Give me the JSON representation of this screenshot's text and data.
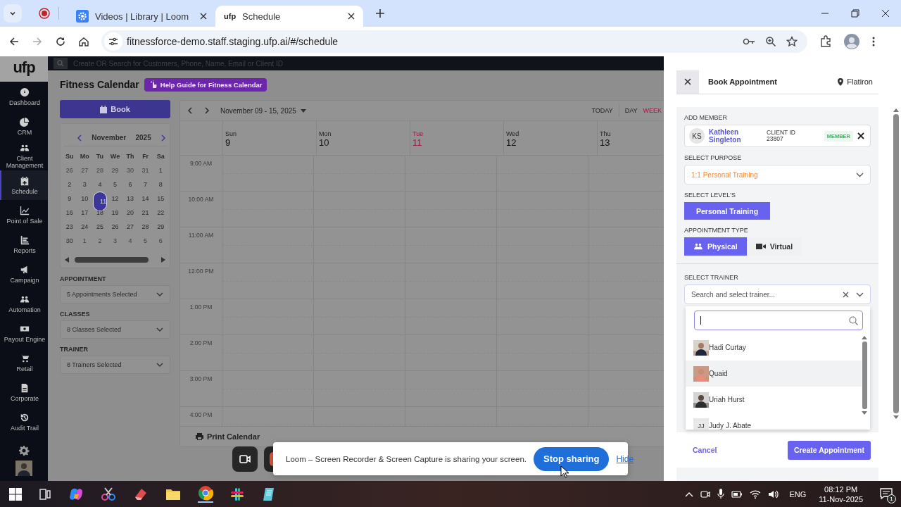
{
  "browser": {
    "tabs": [
      {
        "title": "Videos | Library | Loom",
        "selected": false
      },
      {
        "title": "Schedule",
        "logo": "ufp",
        "selected": true
      }
    ],
    "url": "fitnessforce-demo.staff.staging.ufp.ai/#/schedule"
  },
  "app": {
    "logo": "ufp",
    "search_placeholder": "Create OR Search for Customers, Phone, Name, Email or Client ID",
    "nav": [
      {
        "label": "Dashboard",
        "selected": false
      },
      {
        "label": "CRM",
        "selected": false
      },
      {
        "label": "Client Management",
        "selected": false
      },
      {
        "label": "Schedule",
        "selected": true
      },
      {
        "label": "Point of Sale",
        "selected": false
      },
      {
        "label": "Reports",
        "selected": false
      },
      {
        "label": "Campaign",
        "selected": false
      },
      {
        "label": "Automation",
        "selected": false
      },
      {
        "label": "Payout Engine",
        "selected": false
      },
      {
        "label": "Retail",
        "selected": false
      },
      {
        "label": "Corporate",
        "selected": false
      },
      {
        "label": "Audit Trail",
        "selected": false
      }
    ]
  },
  "calendar": {
    "title": "Fitness Calendar",
    "help": "Help Guide for Fitness Calendar",
    "book": "Book",
    "mini": {
      "month": "November",
      "year": "2025",
      "weekdays": [
        "Su",
        "Mo",
        "Tu",
        "We",
        "Th",
        "Fr",
        "Sa"
      ],
      "weeks": [
        [
          {
            "d": "26",
            "outside": true,
            "selected": false
          },
          {
            "d": "27",
            "outside": true,
            "selected": false
          },
          {
            "d": "28",
            "outside": true,
            "selected": false
          },
          {
            "d": "29",
            "outside": true,
            "selected": false
          },
          {
            "d": "30",
            "outside": true,
            "selected": false
          },
          {
            "d": "31",
            "outside": true,
            "selected": false
          },
          {
            "d": "1",
            "outside": false,
            "selected": false
          }
        ],
        [
          {
            "d": "2",
            "outside": false,
            "selected": false
          },
          {
            "d": "3",
            "outside": false,
            "selected": false
          },
          {
            "d": "4",
            "outside": false,
            "selected": false
          },
          {
            "d": "5",
            "outside": false,
            "selected": false
          },
          {
            "d": "6",
            "outside": false,
            "selected": false
          },
          {
            "d": "7",
            "outside": false,
            "selected": false
          },
          {
            "d": "8",
            "outside": false,
            "selected": false
          }
        ],
        [
          {
            "d": "9",
            "outside": false,
            "selected": false
          },
          {
            "d": "10",
            "outside": false,
            "selected": false
          },
          {
            "d": "11",
            "outside": false,
            "selected": true
          },
          {
            "d": "12",
            "outside": false,
            "selected": false
          },
          {
            "d": "13",
            "outside": false,
            "selected": false
          },
          {
            "d": "14",
            "outside": false,
            "selected": false
          },
          {
            "d": "15",
            "outside": false,
            "selected": false
          }
        ],
        [
          {
            "d": "16",
            "outside": false,
            "selected": false
          },
          {
            "d": "17",
            "outside": false,
            "selected": false
          },
          {
            "d": "18",
            "outside": false,
            "selected": false
          },
          {
            "d": "19",
            "outside": false,
            "selected": false
          },
          {
            "d": "20",
            "outside": false,
            "selected": false
          },
          {
            "d": "21",
            "outside": false,
            "selected": false
          },
          {
            "d": "22",
            "outside": false,
            "selected": false
          }
        ],
        [
          {
            "d": "23",
            "outside": false,
            "selected": false
          },
          {
            "d": "24",
            "outside": false,
            "selected": false
          },
          {
            "d": "25",
            "outside": false,
            "selected": false
          },
          {
            "d": "26",
            "outside": false,
            "selected": false
          },
          {
            "d": "27",
            "outside": false,
            "selected": false
          },
          {
            "d": "28",
            "outside": false,
            "selected": false
          },
          {
            "d": "29",
            "outside": false,
            "selected": false
          }
        ],
        [
          {
            "d": "30",
            "outside": false,
            "selected": false
          },
          {
            "d": "1",
            "outside": true,
            "selected": false
          },
          {
            "d": "2",
            "outside": true,
            "selected": false
          },
          {
            "d": "3",
            "outside": true,
            "selected": false
          },
          {
            "d": "4",
            "outside": true,
            "selected": false
          },
          {
            "d": "5",
            "outside": true,
            "selected": false
          },
          {
            "d": "6",
            "outside": true,
            "selected": false
          }
        ]
      ]
    },
    "filters": [
      {
        "label": "APPOINTMENT",
        "value": "5 Appointments Selected"
      },
      {
        "label": "CLASSES",
        "value": "8 Classes Selected"
      },
      {
        "label": "TRAINER",
        "value": "8 Trainers Selected"
      }
    ],
    "week": {
      "range": "November 09 - 15, 2025",
      "views": [
        {
          "label": "TODAY",
          "selected": false
        },
        {
          "label": "DAY",
          "selected": false
        },
        {
          "label": "WEEK",
          "selected": true
        }
      ],
      "days": [
        {
          "name": "Sun",
          "num": "9",
          "today": false
        },
        {
          "name": "Mon",
          "num": "10",
          "today": false
        },
        {
          "name": "Tue",
          "num": "11",
          "today": true
        },
        {
          "name": "Wed",
          "num": "12",
          "today": false
        },
        {
          "name": "Thu",
          "num": "13",
          "today": false
        }
      ],
      "times": [
        "9:00 AM",
        "10:00 AM",
        "11:00 AM",
        "12:00 PM",
        "1:00 PM",
        "2:00 PM",
        "3:00 PM",
        "4:00 PM"
      ],
      "print": "Print Calendar"
    }
  },
  "drawer": {
    "title": "Book Appointment",
    "location": "Flatiron",
    "member_label": "ADD MEMBER",
    "member": {
      "initials": "KS",
      "name": "Kathleen Singleton",
      "id_label": "CLIENT ID",
      "id": "23807",
      "badge": "MEMBER"
    },
    "purpose_label": "SELECT PURPOSE",
    "purpose": "1:1 Personal Training",
    "level_label": "SELECT LEVEL'S",
    "levels": [
      {
        "label": "Personal Training",
        "selected": true
      }
    ],
    "type_label": "APPOINTMENT TYPE",
    "types": [
      {
        "label": "Physical",
        "selected": true
      },
      {
        "label": "Virtual",
        "selected": false
      }
    ],
    "trainer_label": "SELECT TRAINER",
    "trainer_placeholder": "Search and select trainer...",
    "trainers": [
      {
        "name": "Hadi Curtay",
        "selected": false
      },
      {
        "name": "Quaid",
        "selected": true
      },
      {
        "name": "Uriah Hurst",
        "selected": false
      },
      {
        "name": "Judy J. Abate",
        "kind": "initials",
        "initials": "JJ",
        "selected": false
      }
    ],
    "cancel": "Cancel",
    "create": "Create Appointment"
  },
  "loom": {
    "message": "Loom – Screen Recorder & Screen Capture is sharing your screen.",
    "stop": "Stop sharing",
    "hide": "Hide"
  },
  "taskbar": {
    "language": "ENG",
    "time": "08:12 PM",
    "date": "11-Nov-2025",
    "notifications": "1"
  }
}
